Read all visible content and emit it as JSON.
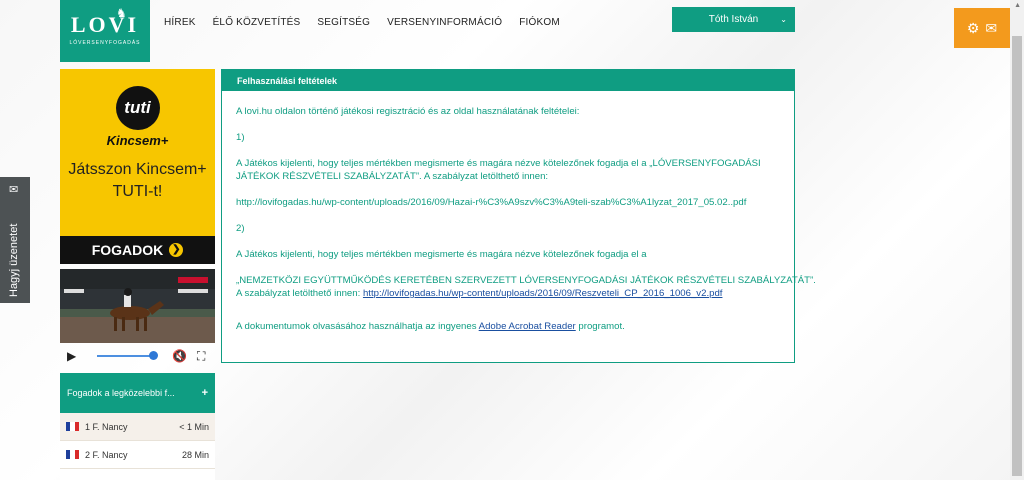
{
  "header": {
    "logo_title": "LOVI",
    "logo_sub": "LÓVERSENYFOGADÁS",
    "nav": [
      "HÍREK",
      "ÉLŐ KÖZVETÍTÉS",
      "SEGÍTSÉG",
      "VERSENYINFORMÁCIÓ",
      "FIÓKOM"
    ],
    "user_name": "Tóth István"
  },
  "contact": {
    "icons": [
      "gear-icon",
      "envelope-icon"
    ],
    "color": "#f39a1d"
  },
  "feedback_tab": {
    "label": "Hagyj üzenetet"
  },
  "ad": {
    "circle_text": "tuti",
    "brand": "Kincsem+",
    "line1": "Játsszon Kincsem+",
    "line2": "TUTI-t!",
    "button": "FOGADOK",
    "color": "#f7c600"
  },
  "bets": {
    "title": "Fogadok a legközelebbi f...",
    "rows": [
      {
        "label": "1 F. Nancy",
        "time": "< 1 Min"
      },
      {
        "label": "2 F. Nancy",
        "time": "28 Min"
      }
    ]
  },
  "panel": {
    "title": "Felhasználási feltételek",
    "intro": "A lovi.hu oldalon történő játékosi regisztráció és az oldal használatának feltételei:",
    "s1": "1)",
    "s1_text": "A Játékos kijelenti, hogy teljes mértékben megismerte és magára nézve kötelezőnek fogadja el a „LÓVERSENYFOGADÁSI JÁTÉKOK RÉSZVÉTELI SZABÁLYZATÁT”. A szabályzat letölthető innen:",
    "s1_link": "http://lovifogadas.hu/wp-content/uploads/2016/09/Hazai-r%C3%A9szv%C3%A9teli-szab%C3%A1lyzat_2017_05.02..pdf",
    "s2": "2)",
    "s2_text": "A Játékos kijelenti, hogy teljes mértékben megismerte és magára nézve kötelezőnek fogadja el a",
    "s2_quote": "„NEMZETKÖZI EGYÜTTMŰKÖDÉS KERETÉBEN SZERVEZETT LÓVERSENYFOGADÁSI JÁTÉKOK RÉSZVÉTELI SZABÁLYZATÁT”.",
    "s2_dl": "A szabályzat letölthető innen:",
    "s2_link": "http://lovifogadas.hu/wp-content/uploads/2016/09/Reszveteli_CP_2016_1006_v2.pdf",
    "footer_pre": "A dokumentumok olvasásához használhatja az ingyenes",
    "footer_link": "Adobe Acrobat Reader",
    "footer_post": "programot."
  },
  "colors": {
    "accent": "#0f9d82",
    "link": "#1a4fa0"
  }
}
